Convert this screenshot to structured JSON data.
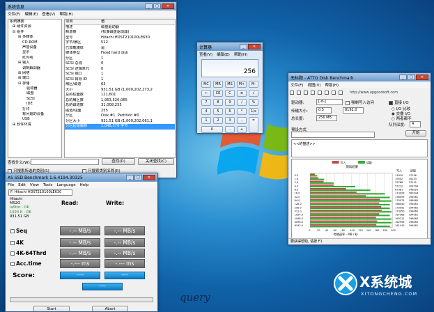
{
  "sysinfo": {
    "title": "系统信息",
    "menu": [
      "文件(F)",
      "编辑(E)",
      "查看(V)",
      "帮助(H)"
    ],
    "tree": [
      "系统摘要",
      "硬件资源",
      "组件",
      "多媒体",
      "CD-ROM",
      "声音设备",
      "显示",
      "红外线",
      "输入",
      "调制解调器",
      "网络",
      "端口",
      "存储",
      "驱动器",
      "磁盘",
      "SCSI",
      "IDE",
      "打印",
      "有问题的设备",
      "USB",
      "软件环境"
    ],
    "col_item": "项目",
    "col_value": "值",
    "rows": [
      [
        "描述",
        "磁盘驱动器"
      ],
      [
        "制造商",
        "(标准磁盘驱动器)"
      ],
      [
        "型号",
        "Hitachi HDST210100LE630"
      ],
      [
        "字节/扇区",
        "512"
      ],
      [
        "已加载媒体",
        "是"
      ],
      [
        "媒体类型",
        "Fixed hard disk"
      ],
      [
        "分区",
        "1"
      ],
      [
        "SCSI 总线",
        "0"
      ],
      [
        "SCSI 逻辑单元",
        "0"
      ],
      [
        "SCSI 端口",
        "1"
      ],
      [
        "SCSI 目标 ID",
        "1"
      ],
      [
        "扇区/磁道",
        "63"
      ],
      [
        "大小",
        "931.51 GB (1,000,202,273,2"
      ],
      [
        "总的柱面数",
        "121,601"
      ],
      [
        "总的扇区数",
        "1,953,520,065"
      ],
      [
        "总的磁道数",
        "31,008,255"
      ],
      [
        "磁道/柱面",
        "255"
      ],
      [
        "分区",
        "Disk #1, Partition #0"
      ],
      [
        "分区大小",
        "931.51 GB (1,000,202,061,1"
      ],
      [
        "分区起始偏移",
        "1,048,576 字节"
      ]
    ],
    "find_label": "查找什么(W):",
    "find_button": "查找(D)",
    "close_find_button": "关闭查找(C)",
    "only_selected": "只搜索所选的类别(S)",
    "only_names": "只搜索类别名称(R)"
  },
  "calculator": {
    "title": "计算器",
    "menu": [
      "查看(V)",
      "编辑(E)",
      "帮助(H)"
    ],
    "display": "256",
    "buttons": [
      [
        "MC",
        "MR",
        "MS",
        "M+",
        "M-"
      ],
      [
        "←",
        "CE",
        "C",
        "±",
        "√"
      ],
      [
        "7",
        "8",
        "9",
        "/",
        "%"
      ],
      [
        "4",
        "5",
        "6",
        "*",
        "1/x"
      ],
      [
        "1",
        "2",
        "3",
        "-",
        "="
      ],
      [
        "0",
        "",
        ".",
        "+",
        ""
      ]
    ]
  },
  "atto": {
    "title": "无标题 - ATTO Disk Benchmark",
    "menu": [
      "文件(F)",
      "视图(V)",
      "帮助(H)"
    ],
    "url": "http://www.upgoodsoft.com",
    "drive_label": "驱动器:",
    "drive_value": "[-d-]",
    "force_write": "强制写入访问",
    "transfer_label": "传输大小:",
    "transfer_from": "0.5",
    "transfer_to": "8192.0",
    "total_label": "总长度:",
    "total_value": "256 MB",
    "direct_io": "直接 I/O",
    "io_compare": "I/O 比较",
    "overlap_io": "交叠 I/O",
    "neither": "两者都不",
    "queue_label": "队列深度:",
    "queue_value": "4",
    "controlled_by": "预设方式",
    "start_button": "开始",
    "desc_label": "<<的描述>>",
    "write_legend": "写入",
    "read_legend": "读取",
    "chart_title": "测试结果",
    "col_write": "写入",
    "col_read": "读取",
    "xaxis_label": "传输速率 - MB / 秒",
    "status": "要获得帮助, 请按 F1"
  },
  "chart_data": {
    "type": "bar",
    "title": "测试结果",
    "xlabel": "传输速率 - MB / 秒",
    "categories": [
      "0.5",
      "1.0",
      "2.0",
      "4.0",
      "8.0",
      "16.0",
      "32.0",
      "64.0",
      "128.0",
      "256.0",
      "512.0",
      "1024.0",
      "2048.0",
      "4096.0",
      "8192.0"
    ],
    "xticks": [
      "0",
      "20",
      "40",
      "60",
      "80",
      "100",
      "120",
      "140",
      "160",
      "180",
      "200"
    ],
    "xlim": [
      0,
      200
    ],
    "series": [
      {
        "name": "写入",
        "values": [
          11.6,
          19.5,
          32.7,
          57.2,
          87.4,
          113.0,
          136.0,
          170.0,
          168.0,
          173.0,
          174.0,
          168.0,
          160.0,
          163.0,
          161.0
        ],
        "color": "#c0504d"
      },
      {
        "name": "读取",
        "values": [
          17.2,
          34.1,
          57.2,
          109.8,
          146.5,
          182.0,
          194.0,
          198.0,
          194.0,
          194.0,
          198.0,
          194.0,
          198.0,
          198.0,
          194.0
        ],
        "color": "#33aa33"
      }
    ],
    "write_labels": [
      "11610",
      "19502",
      "32768",
      "57212",
      "87381",
      "113028",
      "136059",
      "170075",
      "168040",
      "173052",
      "173950",
      "167968",
      "160212",
      "162956",
      "161140"
    ],
    "read_labels": [
      "17236",
      "34133",
      "57212",
      "109794",
      "146520",
      "182044",
      "194061",
      "198060",
      "194061",
      "194061",
      "198060",
      "194061",
      "198060",
      "198060",
      "194061"
    ]
  },
  "asssd": {
    "title": "AS SSD Benchmark 1.6.4194.30325",
    "menu": [
      "File",
      "Edit",
      "View",
      "Tools",
      "Language",
      "Help"
    ],
    "drive_select": "F: Hitachi HDST210100LE630",
    "drive_info": [
      "Hitachi",
      "MS2O",
      "iaStor - OK",
      "1024 K - OK",
      "931.51 GB"
    ],
    "read_header": "Read:",
    "write_header": "Write:",
    "tests": [
      "Seq",
      "4K",
      "4K-64Thrd",
      "Acc.time"
    ],
    "results_read": [
      "-.-- MB/s",
      "-.-- MB/s",
      "-.-- MB/s",
      "-.--- ms"
    ],
    "results_write": [
      "-.-- MB/s",
      "-.-- MB/s",
      "-.-- MB/s",
      "-.--- ms"
    ],
    "score_label": "Score:",
    "score_read": "----",
    "score_write": "----",
    "score_total": "----",
    "start_button": "Start",
    "abort_button": "Abort"
  },
  "watermark": {
    "brand": "X系统城",
    "url": "XITONGCHENG.COM",
    "signature": "query"
  }
}
